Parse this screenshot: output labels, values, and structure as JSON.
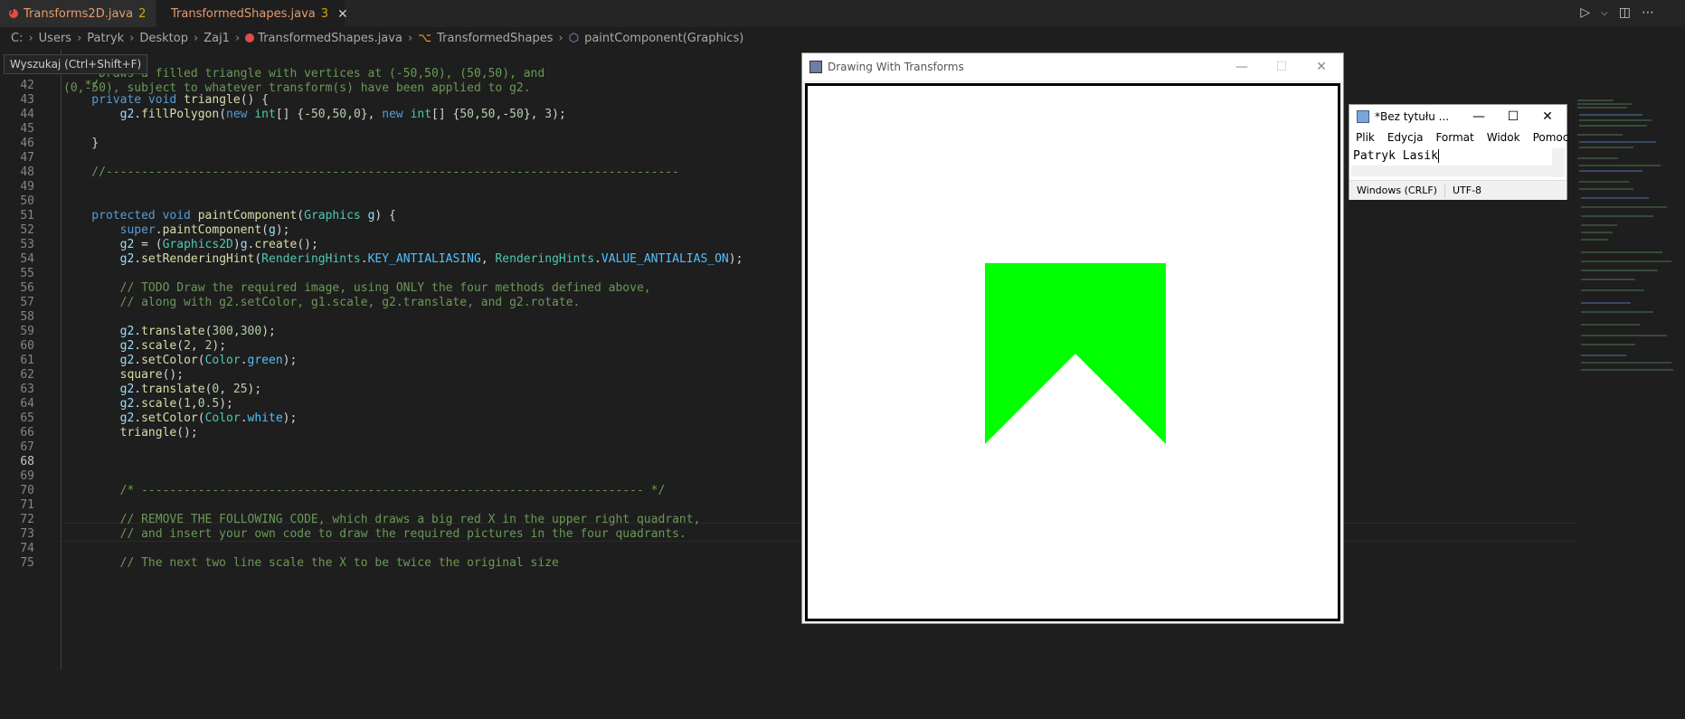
{
  "tabs": [
    {
      "label": "Transforms2D.java",
      "count": "2"
    },
    {
      "label": "TransformedShapes.java",
      "count": "3",
      "close": "✕"
    }
  ],
  "breadcrumb": [
    "C:",
    "Users",
    "Patryk",
    "Desktop",
    "Zaj1",
    "TransformedShapes.java",
    "TransformedShapes",
    "paintComponent(Graphics)"
  ],
  "tooltip": "Wyszukaj (Ctrl+Shift+F)",
  "code_lines": [
    {
      "n": "",
      "text": "   * Draws a filled triangle with vertices at (-50,50), (50,50), and"
    },
    {
      "n": "42",
      "text": "   */"
    },
    {
      "n": "43",
      "text": "    private void triangle() {"
    },
    {
      "n": "44",
      "text": "        g2.fillPolygon(new int[] {-50,50,0}, new int[] {50,50,-50}, 3);"
    },
    {
      "n": "45",
      "text": ""
    },
    {
      "n": "46",
      "text": "    }"
    },
    {
      "n": "47",
      "text": ""
    },
    {
      "n": "48",
      "text": "    //---------------------------------------------------------------------------------"
    },
    {
      "n": "49",
      "text": ""
    },
    {
      "n": "50",
      "text": ""
    },
    {
      "n": "51",
      "text": "    protected void paintComponent(Graphics g) {"
    },
    {
      "n": "52",
      "text": "        super.paintComponent(g);"
    },
    {
      "n": "53",
      "text": "        g2 = (Graphics2D)g.create();"
    },
    {
      "n": "54",
      "text": "        g2.setRenderingHint(RenderingHints.KEY_ANTIALIASING, RenderingHints.VALUE_ANTIALIAS_ON);"
    },
    {
      "n": "55",
      "text": ""
    },
    {
      "n": "56",
      "text": "        // TODO Draw the required image, using ONLY the four methods defined above,"
    },
    {
      "n": "57",
      "text": "        // along with g2.setColor, g1.scale, g2.translate, and g2.rotate."
    },
    {
      "n": "58",
      "text": ""
    },
    {
      "n": "59",
      "text": "        g2.translate(300,300);"
    },
    {
      "n": "60",
      "text": "        g2.scale(2, 2);"
    },
    {
      "n": "61",
      "text": "        g2.setColor(Color.green);"
    },
    {
      "n": "62",
      "text": "        square();"
    },
    {
      "n": "63",
      "text": "        g2.translate(0, 25);"
    },
    {
      "n": "64",
      "text": "        g2.scale(1,0.5);"
    },
    {
      "n": "65",
      "text": "        g2.setColor(Color.white);"
    },
    {
      "n": "66",
      "text": "        triangle();"
    },
    {
      "n": "67",
      "text": ""
    },
    {
      "n": "68",
      "text": ""
    },
    {
      "n": "69",
      "text": ""
    },
    {
      "n": "70",
      "text": "        /* ----------------------------------------------------------------------- */"
    },
    {
      "n": "71",
      "text": ""
    },
    {
      "n": "72",
      "text": "        // REMOVE THE FOLLOWING CODE, which draws a big red X in the upper right quadrant,"
    },
    {
      "n": "73",
      "text": "        // and insert your own code to draw the required pictures in the four quadrants."
    },
    {
      "n": "74",
      "text": ""
    },
    {
      "n": "75",
      "text": "        // The next two line scale the X to be twice the original size"
    }
  ],
  "line41_tail": "(0,-50), subject to whatever transform(s) have been applied to g2.",
  "java_window": {
    "title": "Drawing With Transforms",
    "shape_color": "#00ff00"
  },
  "notepad": {
    "title": "*Bez tytułu ...",
    "menu": [
      "Plik",
      "Edycja",
      "Format",
      "Widok",
      "Pomoc"
    ],
    "text": "Patryk Lasik",
    "status_eol": "Windows (CRLF)",
    "status_enc": "UTF-8"
  }
}
